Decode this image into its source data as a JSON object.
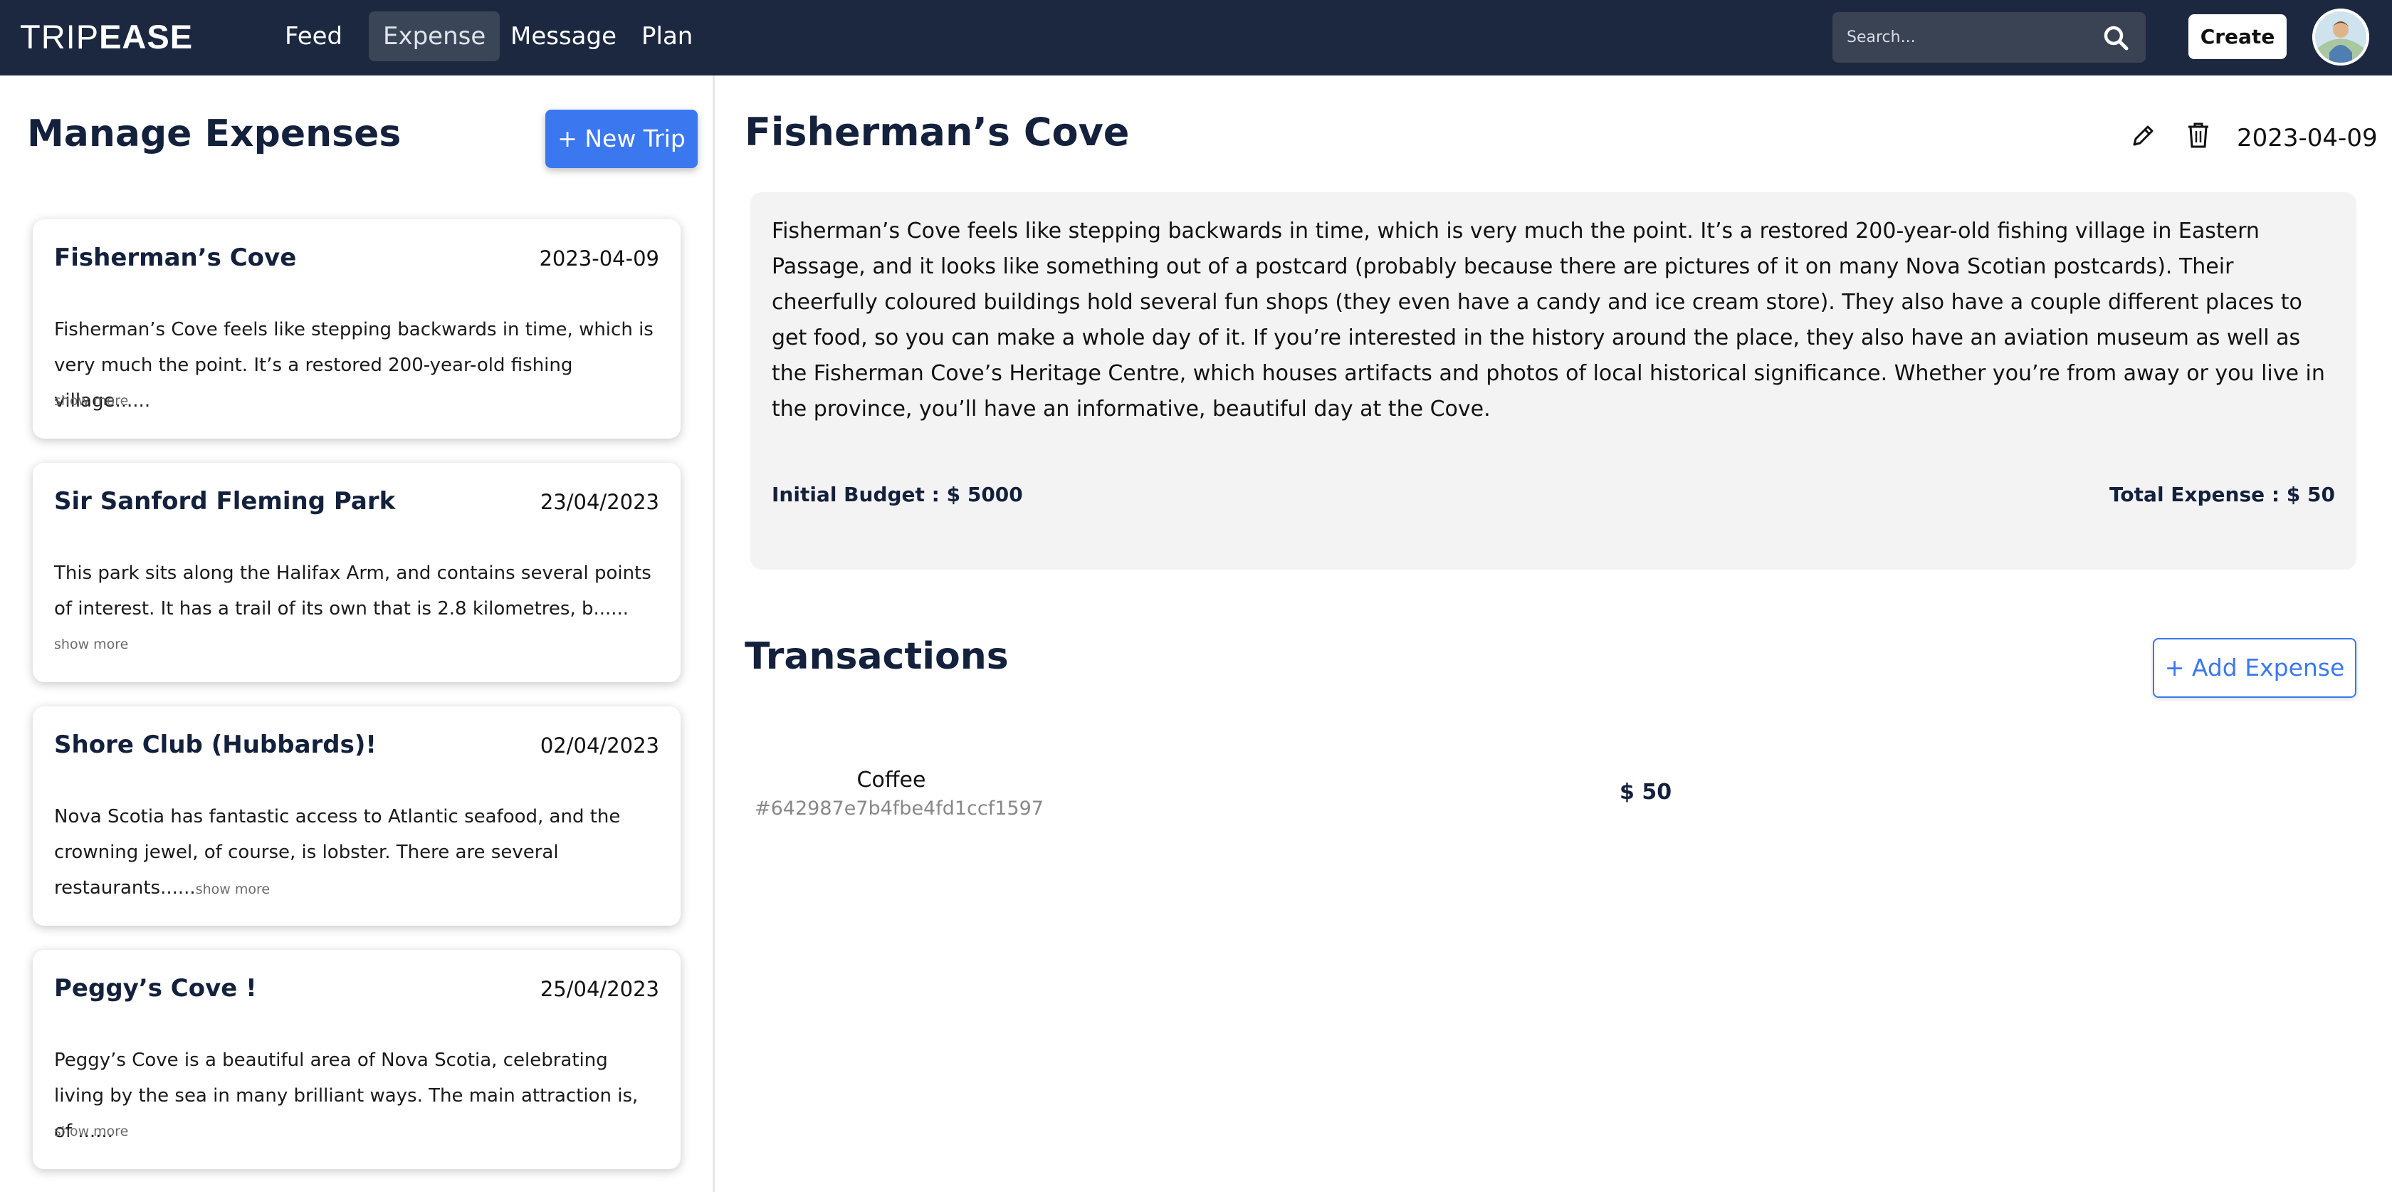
{
  "app": {
    "logo_light": "TRIP",
    "logo_bold": "EASE"
  },
  "nav": {
    "items": [
      {
        "label": "Feed",
        "active": false
      },
      {
        "label": "Expense",
        "active": true
      },
      {
        "label": "Message",
        "active": false
      },
      {
        "label": "Plan",
        "active": false
      }
    ],
    "search_placeholder": "Search...",
    "create_label": "Create"
  },
  "sidebar": {
    "title": "Manage Expenses",
    "new_trip_label": "+ New Trip",
    "trips": [
      {
        "name": "Fisherman’s Cove",
        "date": "2023-04-09",
        "description": "Fisherman’s Cove feels like stepping backwards in time, which is very much the point. It’s a restored 200-year-old fishing village......",
        "show_more": "show more"
      },
      {
        "name": "Sir Sanford Fleming Park",
        "date": "23/04/2023",
        "description": "This park sits along the Halifax Arm, and contains several points of interest. It has a trail of its own that is 2.8 kilometres, b......",
        "show_more": "show more"
      },
      {
        "name": "Shore Club (Hubbards)!",
        "date": "02/04/2023",
        "description": "Nova Scotia has fantastic access to Atlantic seafood, and the crowning jewel, of course, is lobster. There are several restaurants......",
        "show_more": "show more"
      },
      {
        "name": "Peggy’s Cove !",
        "date": "25/04/2023",
        "description": "Peggy’s Cove is a beautiful area of Nova Scotia, celebrating living by the sea in many brilliant ways. The main attraction is, of ......",
        "show_more": "show more"
      }
    ]
  },
  "detail": {
    "title": "Fisherman’s Cove",
    "date": "2023-04-09",
    "description": "Fisherman’s Cove feels like stepping backwards in time, which is very much the point. It’s a restored 200-year-old fishing village in Eastern Passage, and it looks like something out of a postcard (probably because there are pictures of it on many Nova Scotian postcards). Their cheerfully coloured buildings hold several fun shops (they even have a candy and ice cream store). They also have a couple different places to get food, so you can make a whole day of it. If you’re interested in the history around the place, they also have an aviation museum as well as the Fisherman Cove’s Heritage Centre, which houses artifacts and photos of local historical significance. Whether you’re from away or you live in the province, you’ll have an informative, beautiful day at the Cove.",
    "initial_budget": "Initial Budget : $ 5000",
    "total_expense": "Total Expense : $ 50"
  },
  "transactions": {
    "title": "Transactions",
    "add_label": "+ Add Expense",
    "rows": [
      {
        "name": "Coffee",
        "id": "#642987e7b4fbe4fd1ccf1597",
        "amount": "$ 50"
      }
    ]
  },
  "colors": {
    "navbar": "#1b2840",
    "accent": "#3b78f0",
    "heading": "#14213d",
    "card_bg": "#f3f3f3"
  },
  "icons": [
    "search-icon",
    "pencil-icon",
    "trash-icon",
    "avatar"
  ]
}
